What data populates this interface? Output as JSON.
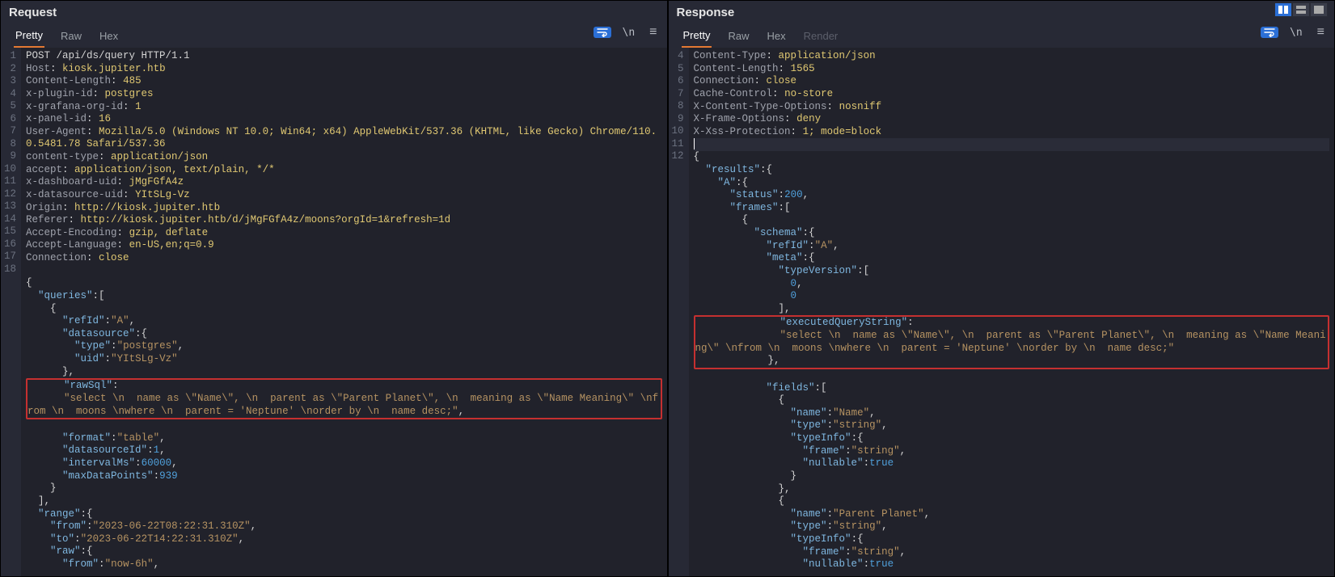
{
  "request": {
    "title": "Request",
    "tabs": {
      "pretty": "Pretty",
      "raw": "Raw",
      "hex": "Hex"
    },
    "lines": [
      {
        "n": 1,
        "type": "start",
        "text": "POST /api/ds/query HTTP/1.1"
      },
      {
        "n": 2,
        "type": "hdr",
        "name": "Host",
        "value": "kiosk.jupiter.htb"
      },
      {
        "n": 3,
        "type": "hdr",
        "name": "Content-Length",
        "value": "485"
      },
      {
        "n": 4,
        "type": "hdr",
        "name": "x-plugin-id",
        "value": "postgres"
      },
      {
        "n": 5,
        "type": "hdr",
        "name": "x-grafana-org-id",
        "value": "1"
      },
      {
        "n": 6,
        "type": "hdr",
        "name": "x-panel-id",
        "value": "16"
      },
      {
        "n": 7,
        "type": "hdr",
        "name": "User-Agent",
        "value": "Mozilla/5.0 (Windows NT 10.0; Win64; x64) AppleWebKit/537.36 (KHTML, like Gecko) Chrome/110.0.5481.78 Safari/537.36"
      },
      {
        "n": 8,
        "type": "hdr",
        "name": "content-type",
        "value": "application/json"
      },
      {
        "n": 9,
        "type": "hdr",
        "name": "accept",
        "value": "application/json, text/plain, */*"
      },
      {
        "n": 10,
        "type": "hdr",
        "name": "x-dashboard-uid",
        "value": "jMgFGfA4z"
      },
      {
        "n": 11,
        "type": "hdr",
        "name": "x-datasource-uid",
        "value": "YItSLg-Vz"
      },
      {
        "n": 12,
        "type": "hdr",
        "name": "Origin",
        "value": "http://kiosk.jupiter.htb"
      },
      {
        "n": 13,
        "type": "hdr",
        "name": "Referer",
        "value": "http://kiosk.jupiter.htb/d/jMgFGfA4z/moons?orgId=1&refresh=1d"
      },
      {
        "n": 14,
        "type": "hdr",
        "name": "Accept-Encoding",
        "value": "gzip, deflate"
      },
      {
        "n": 15,
        "type": "hdr",
        "name": "Accept-Language",
        "value": "en-US,en;q=0.9"
      },
      {
        "n": 16,
        "type": "hdr",
        "name": "Connection",
        "value": "close"
      },
      {
        "n": 17,
        "type": "blank",
        "text": ""
      },
      {
        "n": 18,
        "type": "body"
      }
    ],
    "body_tokens": [
      {
        "t": "p",
        "v": "{"
      },
      {
        "t": "nl"
      },
      {
        "t": "i",
        "v": 1
      },
      {
        "t": "k",
        "v": "\"queries\""
      },
      {
        "t": "p",
        "v": ":["
      },
      {
        "t": "nl"
      },
      {
        "t": "i",
        "v": 2
      },
      {
        "t": "p",
        "v": "{"
      },
      {
        "t": "nl"
      },
      {
        "t": "i",
        "v": 3
      },
      {
        "t": "k",
        "v": "\"refId\""
      },
      {
        "t": "p",
        "v": ":"
      },
      {
        "t": "s",
        "v": "\"A\""
      },
      {
        "t": "p",
        "v": ","
      },
      {
        "t": "nl"
      },
      {
        "t": "i",
        "v": 3
      },
      {
        "t": "k",
        "v": "\"datasource\""
      },
      {
        "t": "p",
        "v": ":{"
      },
      {
        "t": "nl"
      },
      {
        "t": "i",
        "v": 4
      },
      {
        "t": "k",
        "v": "\"type\""
      },
      {
        "t": "p",
        "v": ":"
      },
      {
        "t": "s",
        "v": "\"postgres\""
      },
      {
        "t": "p",
        "v": ","
      },
      {
        "t": "nl"
      },
      {
        "t": "i",
        "v": 4
      },
      {
        "t": "k",
        "v": "\"uid\""
      },
      {
        "t": "p",
        "v": ":"
      },
      {
        "t": "s",
        "v": "\"YItSLg-Vz\""
      },
      {
        "t": "nl"
      },
      {
        "t": "i",
        "v": 3
      },
      {
        "t": "p",
        "v": "},"
      },
      {
        "t": "nl"
      },
      {
        "t": "box-start"
      },
      {
        "t": "i",
        "v": 3
      },
      {
        "t": "k",
        "v": "\"rawSql\""
      },
      {
        "t": "p",
        "v": ":"
      },
      {
        "t": "nl"
      },
      {
        "t": "i",
        "v": 3
      },
      {
        "t": "s",
        "v": "\"select \\n  name as \\\"Name\\\", \\n  parent as \\\"Parent Planet\\\", \\n  meaning as \\\"Name Meaning\\\" \\nfrom \\n  moons \\nwhere \\n  parent = 'Neptune' \\norder by \\n  name desc;\""
      },
      {
        "t": "p",
        "v": ","
      },
      {
        "t": "box-end"
      },
      {
        "t": "nl"
      },
      {
        "t": "i",
        "v": 3
      },
      {
        "t": "k",
        "v": "\"format\""
      },
      {
        "t": "p",
        "v": ":"
      },
      {
        "t": "s",
        "v": "\"table\""
      },
      {
        "t": "p",
        "v": ","
      },
      {
        "t": "nl"
      },
      {
        "t": "i",
        "v": 3
      },
      {
        "t": "k",
        "v": "\"datasourceId\""
      },
      {
        "t": "p",
        "v": ":"
      },
      {
        "t": "n",
        "v": "1"
      },
      {
        "t": "p",
        "v": ","
      },
      {
        "t": "nl"
      },
      {
        "t": "i",
        "v": 3
      },
      {
        "t": "k",
        "v": "\"intervalMs\""
      },
      {
        "t": "p",
        "v": ":"
      },
      {
        "t": "n",
        "v": "60000"
      },
      {
        "t": "p",
        "v": ","
      },
      {
        "t": "nl"
      },
      {
        "t": "i",
        "v": 3
      },
      {
        "t": "k",
        "v": "\"maxDataPoints\""
      },
      {
        "t": "p",
        "v": ":"
      },
      {
        "t": "n",
        "v": "939"
      },
      {
        "t": "nl"
      },
      {
        "t": "i",
        "v": 2
      },
      {
        "t": "p",
        "v": "}"
      },
      {
        "t": "nl"
      },
      {
        "t": "i",
        "v": 1
      },
      {
        "t": "p",
        "v": "],"
      },
      {
        "t": "nl"
      },
      {
        "t": "i",
        "v": 1
      },
      {
        "t": "k",
        "v": "\"range\""
      },
      {
        "t": "p",
        "v": ":{"
      },
      {
        "t": "nl"
      },
      {
        "t": "i",
        "v": 2
      },
      {
        "t": "k",
        "v": "\"from\""
      },
      {
        "t": "p",
        "v": ":"
      },
      {
        "t": "s",
        "v": "\"2023-06-22T08:22:31.310Z\""
      },
      {
        "t": "p",
        "v": ","
      },
      {
        "t": "nl"
      },
      {
        "t": "i",
        "v": 2
      },
      {
        "t": "k",
        "v": "\"to\""
      },
      {
        "t": "p",
        "v": ":"
      },
      {
        "t": "s",
        "v": "\"2023-06-22T14:22:31.310Z\""
      },
      {
        "t": "p",
        "v": ","
      },
      {
        "t": "nl"
      },
      {
        "t": "i",
        "v": 2
      },
      {
        "t": "k",
        "v": "\"raw\""
      },
      {
        "t": "p",
        "v": ":{"
      },
      {
        "t": "nl"
      },
      {
        "t": "i",
        "v": 3
      },
      {
        "t": "k",
        "v": "\"from\""
      },
      {
        "t": "p",
        "v": ":"
      },
      {
        "t": "s",
        "v": "\"now-6h\""
      },
      {
        "t": "p",
        "v": ","
      }
    ]
  },
  "response": {
    "title": "Response",
    "tabs": {
      "pretty": "Pretty",
      "raw": "Raw",
      "hex": "Hex",
      "render": "Render"
    },
    "lines": [
      {
        "n": 4,
        "type": "hdr",
        "name": "Content-Type",
        "value": "application/json"
      },
      {
        "n": 5,
        "type": "hdr",
        "name": "Content-Length",
        "value": "1565"
      },
      {
        "n": 6,
        "type": "hdr",
        "name": "Connection",
        "value": "close"
      },
      {
        "n": 7,
        "type": "hdr",
        "name": "Cache-Control",
        "value": "no-store"
      },
      {
        "n": 8,
        "type": "hdr",
        "name": "X-Content-Type-Options",
        "value": "nosniff"
      },
      {
        "n": 9,
        "type": "hdr",
        "name": "X-Frame-Options",
        "value": "deny"
      },
      {
        "n": 10,
        "type": "hdr",
        "name": "X-Xss-Protection",
        "value": "1; mode=block"
      },
      {
        "n": 11,
        "type": "cursor"
      },
      {
        "n": 12,
        "type": "body"
      }
    ],
    "body_tokens": [
      {
        "t": "p",
        "v": "{"
      },
      {
        "t": "nl"
      },
      {
        "t": "i",
        "v": 1
      },
      {
        "t": "k",
        "v": "\"results\""
      },
      {
        "t": "p",
        "v": ":{"
      },
      {
        "t": "nl"
      },
      {
        "t": "i",
        "v": 2
      },
      {
        "t": "k",
        "v": "\"A\""
      },
      {
        "t": "p",
        "v": ":{"
      },
      {
        "t": "nl"
      },
      {
        "t": "i",
        "v": 3
      },
      {
        "t": "k",
        "v": "\"status\""
      },
      {
        "t": "p",
        "v": ":"
      },
      {
        "t": "n",
        "v": "200"
      },
      {
        "t": "p",
        "v": ","
      },
      {
        "t": "nl"
      },
      {
        "t": "i",
        "v": 3
      },
      {
        "t": "k",
        "v": "\"frames\""
      },
      {
        "t": "p",
        "v": ":["
      },
      {
        "t": "nl"
      },
      {
        "t": "i",
        "v": 4
      },
      {
        "t": "p",
        "v": "{"
      },
      {
        "t": "nl"
      },
      {
        "t": "i",
        "v": 5
      },
      {
        "t": "k",
        "v": "\"schema\""
      },
      {
        "t": "p",
        "v": ":{"
      },
      {
        "t": "nl"
      },
      {
        "t": "i",
        "v": 6
      },
      {
        "t": "k",
        "v": "\"refId\""
      },
      {
        "t": "p",
        "v": ":"
      },
      {
        "t": "s",
        "v": "\"A\""
      },
      {
        "t": "p",
        "v": ","
      },
      {
        "t": "nl"
      },
      {
        "t": "i",
        "v": 6
      },
      {
        "t": "k",
        "v": "\"meta\""
      },
      {
        "t": "p",
        "v": ":{"
      },
      {
        "t": "nl"
      },
      {
        "t": "i",
        "v": 7
      },
      {
        "t": "k",
        "v": "\"typeVersion\""
      },
      {
        "t": "p",
        "v": ":["
      },
      {
        "t": "nl"
      },
      {
        "t": "i",
        "v": 8
      },
      {
        "t": "n",
        "v": "0"
      },
      {
        "t": "p",
        "v": ","
      },
      {
        "t": "nl"
      },
      {
        "t": "i",
        "v": 8
      },
      {
        "t": "n",
        "v": "0"
      },
      {
        "t": "nl"
      },
      {
        "t": "i",
        "v": 7
      },
      {
        "t": "p",
        "v": "],"
      },
      {
        "t": "nl"
      },
      {
        "t": "box-start"
      },
      {
        "t": "i",
        "v": 7
      },
      {
        "t": "k",
        "v": "\"executedQueryString\""
      },
      {
        "t": "p",
        "v": ":"
      },
      {
        "t": "nl"
      },
      {
        "t": "i",
        "v": 7
      },
      {
        "t": "s",
        "v": "\"select \\n  name as \\\"Name\\\", \\n  parent as \\\"Parent Planet\\\", \\n  meaning as \\\"Name Meaning\\\" \\nfrom \\n  moons \\nwhere \\n  parent = 'Neptune' \\norder by \\n  name desc;\""
      },
      {
        "t": "nl"
      },
      {
        "t": "i",
        "v": 6
      },
      {
        "t": "p",
        "v": "},"
      },
      {
        "t": "box-end"
      },
      {
        "t": "nl"
      },
      {
        "t": "i",
        "v": 6
      },
      {
        "t": "k",
        "v": "\"fields\""
      },
      {
        "t": "p",
        "v": ":["
      },
      {
        "t": "nl"
      },
      {
        "t": "i",
        "v": 7
      },
      {
        "t": "p",
        "v": "{"
      },
      {
        "t": "nl"
      },
      {
        "t": "i",
        "v": 8
      },
      {
        "t": "k",
        "v": "\"name\""
      },
      {
        "t": "p",
        "v": ":"
      },
      {
        "t": "s",
        "v": "\"Name\""
      },
      {
        "t": "p",
        "v": ","
      },
      {
        "t": "nl"
      },
      {
        "t": "i",
        "v": 8
      },
      {
        "t": "k",
        "v": "\"type\""
      },
      {
        "t": "p",
        "v": ":"
      },
      {
        "t": "s",
        "v": "\"string\""
      },
      {
        "t": "p",
        "v": ","
      },
      {
        "t": "nl"
      },
      {
        "t": "i",
        "v": 8
      },
      {
        "t": "k",
        "v": "\"typeInfo\""
      },
      {
        "t": "p",
        "v": ":{"
      },
      {
        "t": "nl"
      },
      {
        "t": "i",
        "v": 9
      },
      {
        "t": "k",
        "v": "\"frame\""
      },
      {
        "t": "p",
        "v": ":"
      },
      {
        "t": "s",
        "v": "\"string\""
      },
      {
        "t": "p",
        "v": ","
      },
      {
        "t": "nl"
      },
      {
        "t": "i",
        "v": 9
      },
      {
        "t": "k",
        "v": "\"nullable\""
      },
      {
        "t": "p",
        "v": ":"
      },
      {
        "t": "n",
        "v": "true"
      },
      {
        "t": "nl"
      },
      {
        "t": "i",
        "v": 8
      },
      {
        "t": "p",
        "v": "}"
      },
      {
        "t": "nl"
      },
      {
        "t": "i",
        "v": 7
      },
      {
        "t": "p",
        "v": "},"
      },
      {
        "t": "nl"
      },
      {
        "t": "i",
        "v": 7
      },
      {
        "t": "p",
        "v": "{"
      },
      {
        "t": "nl"
      },
      {
        "t": "i",
        "v": 8
      },
      {
        "t": "k",
        "v": "\"name\""
      },
      {
        "t": "p",
        "v": ":"
      },
      {
        "t": "s",
        "v": "\"Parent Planet\""
      },
      {
        "t": "p",
        "v": ","
      },
      {
        "t": "nl"
      },
      {
        "t": "i",
        "v": 8
      },
      {
        "t": "k",
        "v": "\"type\""
      },
      {
        "t": "p",
        "v": ":"
      },
      {
        "t": "s",
        "v": "\"string\""
      },
      {
        "t": "p",
        "v": ","
      },
      {
        "t": "nl"
      },
      {
        "t": "i",
        "v": 8
      },
      {
        "t": "k",
        "v": "\"typeInfo\""
      },
      {
        "t": "p",
        "v": ":{"
      },
      {
        "t": "nl"
      },
      {
        "t": "i",
        "v": 9
      },
      {
        "t": "k",
        "v": "\"frame\""
      },
      {
        "t": "p",
        "v": ":"
      },
      {
        "t": "s",
        "v": "\"string\""
      },
      {
        "t": "p",
        "v": ","
      },
      {
        "t": "nl"
      },
      {
        "t": "i",
        "v": 9
      },
      {
        "t": "k",
        "v": "\"nullable\""
      },
      {
        "t": "p",
        "v": ":"
      },
      {
        "t": "n",
        "v": "true"
      }
    ]
  },
  "icons": {
    "newline_label": "\\n",
    "menu_label": "≡"
  }
}
